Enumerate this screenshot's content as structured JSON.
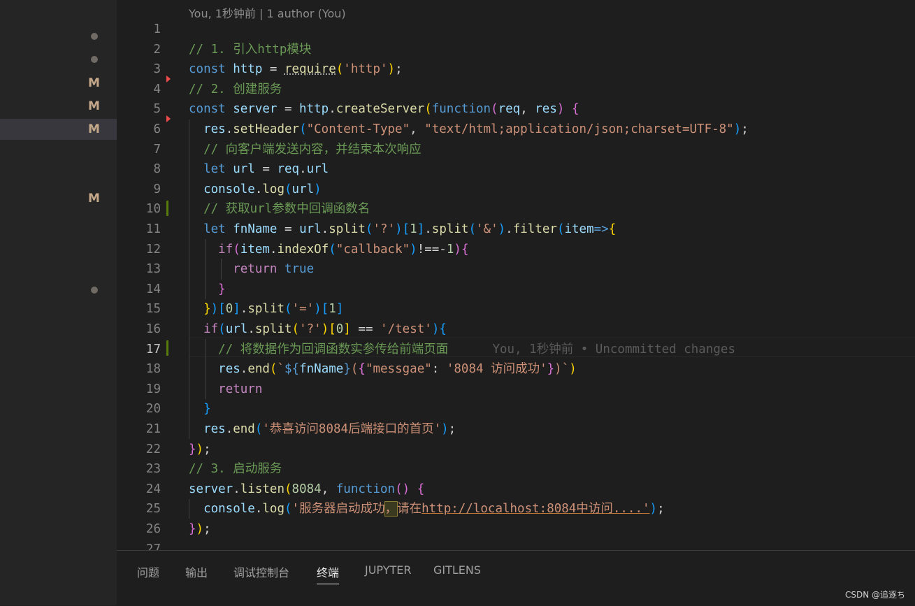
{
  "codelens": "You, 1秒钟前 | 1 author (You)",
  "scm_markers": [
    {
      "type": "dot"
    },
    {
      "type": "dot"
    },
    {
      "type": "M",
      "label": "M"
    },
    {
      "type": "M",
      "label": "M"
    },
    {
      "type": "M",
      "label": "M",
      "active": true
    },
    {
      "type": "M",
      "label": "M"
    },
    {
      "type": "dot"
    }
  ],
  "line_numbers": [
    "1",
    "2",
    "3",
    "4",
    "5",
    "6",
    "7",
    "8",
    "9",
    "10",
    "11",
    "12",
    "13",
    "14",
    "15",
    "16",
    "17",
    "18",
    "19",
    "20",
    "21",
    "22",
    "23",
    "24",
    "25",
    "26",
    "27"
  ],
  "current_line": "17",
  "inline_blame": "You, 1秒钟前 • Uncommitted changes",
  "code": {
    "l2": "// 1. 引入http模块",
    "l4": "// 2. 创建服务",
    "l7": "// 向客户端发送内容，并结束本次响应",
    "l10": "// 获取url参数中回调函数名",
    "l17": "// 将数据作为回调函数实参传给前端页面",
    "l23": "// 3. 启动服务",
    "s_http": "'http'",
    "s_content_type": "\"Content-Type\"",
    "s_mime": "\"text/html;application/json;charset=UTF-8\"",
    "s_q": "'?'",
    "s_amp": "'&'",
    "s_callback": "\"callback\"",
    "s_eq": "'='",
    "s_test": "'/test'",
    "s_messgae_key": "\"messgae\"",
    "s_messgae_val": "'8084 访问成功'",
    "s_welcome": "'恭喜访问8084后端接口的首页'",
    "s_log_a": "'服务器启动成功",
    "s_log_b": "，",
    "s_log_c": "请在",
    "s_log_d": "http://localhost:8084中访问....'",
    "port": "8084"
  },
  "panel_tabs": [
    "问题",
    "输出",
    "调试控制台",
    "终端",
    "JUPYTER",
    "GITLENS"
  ],
  "active_tab": "终端",
  "watermark": "CSDN @追逐ち"
}
